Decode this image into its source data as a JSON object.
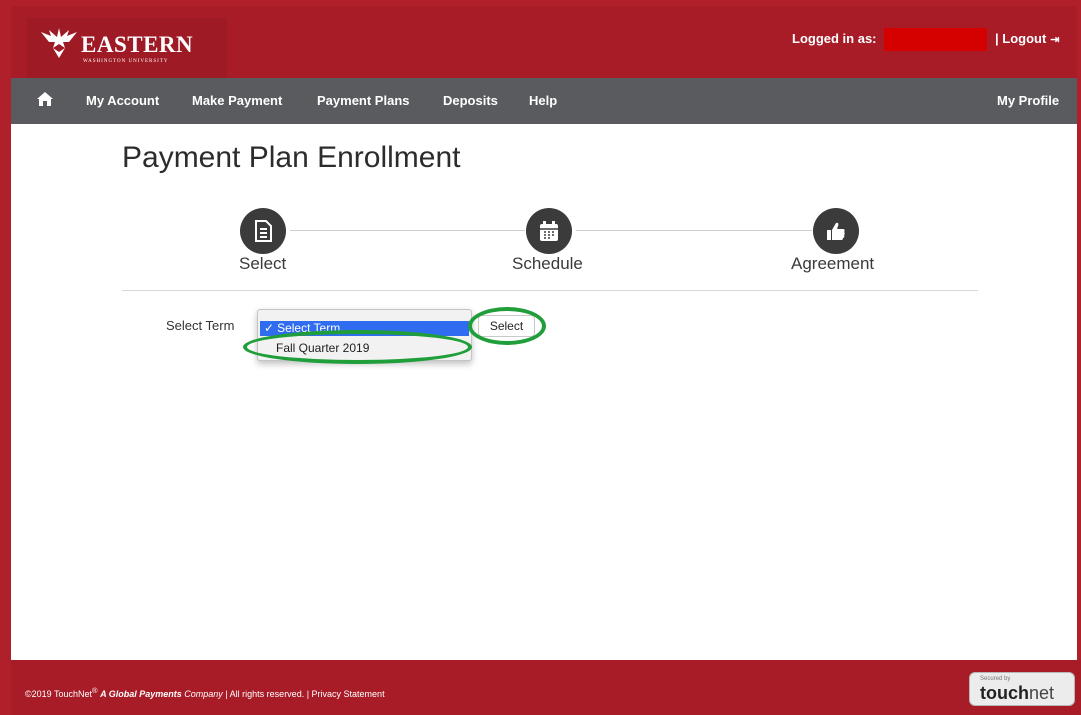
{
  "header": {
    "logo_title": "EASTERN",
    "logo_subtitle": "WASHINGTON UNIVERSITY",
    "logged_in_label": "Logged in as:",
    "logout_label": "| Logout",
    "logout_icon": "sign-out-icon",
    "bar_color": "#a81c28"
  },
  "nav": {
    "home_icon": "home-icon",
    "items": [
      {
        "label": "My Account"
      },
      {
        "label": "Make Payment"
      },
      {
        "label": "Payment Plans"
      },
      {
        "label": "Deposits"
      },
      {
        "label": "Help"
      }
    ],
    "profile_label": "My Profile",
    "bar_color": "#595b5e"
  },
  "page": {
    "title": "Payment Plan Enrollment"
  },
  "steps": [
    {
      "label": "Select",
      "icon": "document-icon",
      "active": true
    },
    {
      "label": "Schedule",
      "icon": "calendar-icon",
      "active": false
    },
    {
      "label": "Agreement",
      "icon": "thumbs-up-icon",
      "active": false
    }
  ],
  "form": {
    "term_label": "Select Term",
    "dropdown_selected": "Select Term",
    "dropdown_options": [
      "Select Term",
      "Fall Quarter 2019"
    ],
    "select_button": "Select",
    "annotation_color": "#1f9e3a"
  },
  "footer": {
    "copyright_prefix": "©2019 TouchNet",
    "registered_mark": "®",
    "company": "A Global Payments",
    "company_suffix": "Company",
    "rights": "| All rights reserved. | Privacy Statement",
    "badge_secured": "Secured by",
    "badge_brand_bold": "touch",
    "badge_brand_light": "net"
  }
}
